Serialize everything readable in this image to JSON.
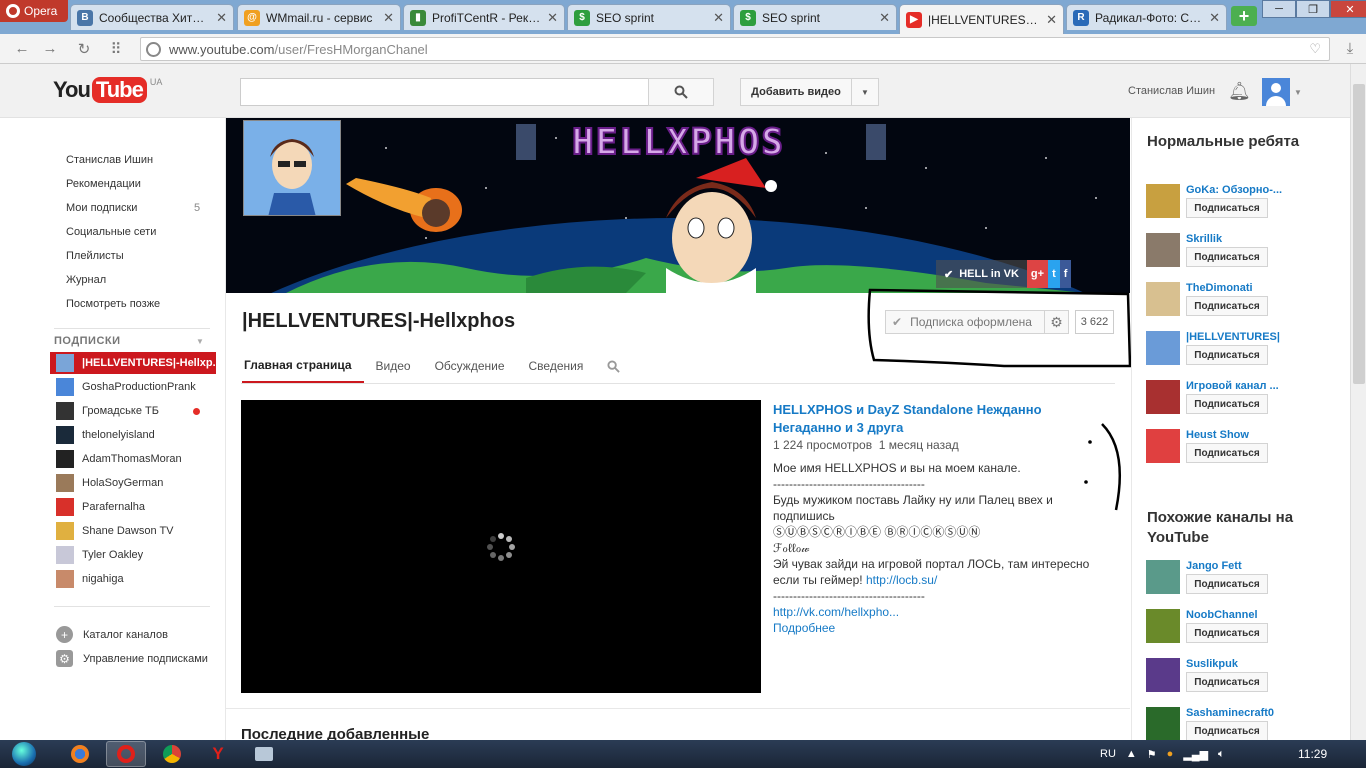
{
  "browser": {
    "menu_label": "Opera",
    "tabs": [
      {
        "title": "Сообщества Хитрак",
        "icon": "vk-icon",
        "color": "#4a76a8",
        "glyph": "B"
      },
      {
        "title": "WMmail.ru - сервис",
        "icon": "wmmail-icon",
        "color": "#f0a020",
        "glyph": "@"
      },
      {
        "title": "ProfiTCentR - Реклам",
        "icon": "profitcentr-icon",
        "color": "#3a8a3a",
        "glyph": "▮"
      },
      {
        "title": "SEO sprint",
        "icon": "seosprint-icon",
        "color": "#2e9e3e",
        "glyph": "$"
      },
      {
        "title": "SEO sprint",
        "icon": "seosprint-icon",
        "color": "#2e9e3e",
        "glyph": "$"
      },
      {
        "title": "|HELLVENTURES|-He",
        "icon": "youtube-icon",
        "color": "#e52d27",
        "glyph": "▶"
      },
      {
        "title": "Радикал-Фото: Созд",
        "icon": "radikal-icon",
        "color": "#2a6ab8",
        "glyph": "R"
      }
    ],
    "url_host": "www.youtube.com",
    "url_path": "/user/FresHMorganChanel"
  },
  "header": {
    "logo_you": "You",
    "logo_tube": "Tube",
    "region": "UA",
    "search_placeholder": "",
    "upload_label": "Добавить видео",
    "username": "Станислав Ишин"
  },
  "guide": {
    "items": [
      {
        "label": "Станислав Ишин",
        "count": ""
      },
      {
        "label": "Рекомендации",
        "count": ""
      },
      {
        "label": "Мои подписки",
        "count": "5"
      },
      {
        "label": "Социальные сети",
        "count": ""
      },
      {
        "label": "Плейлисты",
        "count": ""
      },
      {
        "label": "Журнал",
        "count": ""
      },
      {
        "label": "Посмотреть позже",
        "count": ""
      }
    ],
    "subs_heading": "ПОДПИСКИ",
    "subscriptions": [
      {
        "label": "|HELLVENTURES|-Hellxp...",
        "color": "#7aa5d8",
        "active": true
      },
      {
        "label": "GoshaProductionPrank",
        "color": "#4a86d9"
      },
      {
        "label": "Громадське ТБ",
        "color": "#333",
        "dot": true
      },
      {
        "label": "thelonelyisland",
        "color": "#1a2a3a"
      },
      {
        "label": "AdamThomasMoran",
        "color": "#222"
      },
      {
        "label": "HolaSoyGerman",
        "color": "#9a7a5a"
      },
      {
        "label": "Parafernalha",
        "color": "#d8302a"
      },
      {
        "label": "Shane Dawson TV",
        "color": "#e0b040"
      },
      {
        "label": "Tyler Oakley",
        "color": "#c8c8d8"
      },
      {
        "label": "nigahiga",
        "color": "#c88a6a"
      }
    ],
    "browse_channels": "Каталог каналов",
    "manage_subs": "Управление подписками"
  },
  "channel": {
    "banner_title": "HELLXPHOS",
    "banner_links": [
      "HELL in VK",
      "g+",
      "t",
      "f"
    ],
    "title": "|HELLVENTURES|-Hellxphos",
    "subscribed_label": "Подписка оформлена",
    "subscriber_count": "3 622",
    "tabs": [
      "Главная страница",
      "Видео",
      "Обсуждение",
      "Сведения"
    ]
  },
  "featured": {
    "title": "HELLXPHOS и DayZ Standalone Нежданно Негаданно и 3 друга",
    "views": "1 224 просмотров",
    "age": "1 месяц назад",
    "description_lines": [
      "Мое имя HELLXPHOS и вы на моем канале.",
      "--------------------------------------",
      "Будь мужиком поставь Лайку ну или Палец ввех и",
      "подпишись",
      "ⓈⓊⒷⓈⒸⓇⒾⒷⒺ ⒷⓇⒾⒸⓀⓈⓊⓃ",
      "ℱℴℓℓℴ𝓌",
      "Эй чувак зайди на игровой портал ЛОСЬ, там интересно",
      "если ты геймер! "
    ],
    "link1": "http://locb.su/",
    "separator": "--------------------------------------",
    "link2": "http://vk.com/hellxpho...",
    "more": "Подробнее"
  },
  "section": {
    "latest": "Последние добавленные"
  },
  "rail": {
    "heading1": "Нормальные ребята",
    "heading2": "Похожие каналы на YouTube",
    "subscribe_label": "Подписаться",
    "group1": [
      {
        "name": "GoKa: Обзорно-...",
        "color": "#c8a040"
      },
      {
        "name": "Skrillik",
        "color": "#8a7a6a"
      },
      {
        "name": "TheDimonati",
        "color": "#d8c090"
      },
      {
        "name": "|HELLVENTURES|",
        "color": "#6a9bd8"
      },
      {
        "name": "Игровой канал ...",
        "color": "#a83030"
      },
      {
        "name": "Heust Show",
        "color": "#e04040"
      }
    ],
    "group2": [
      {
        "name": "Jango Fett",
        "color": "#5a9a8a"
      },
      {
        "name": "NoobChannel",
        "color": "#6a8a2a"
      },
      {
        "name": "Suslikpuk",
        "color": "#5a3a8a"
      },
      {
        "name": "Sashaminecraft0",
        "color": "#2a6a2a"
      }
    ]
  },
  "taskbar": {
    "lang": "RU",
    "time": "11:29"
  }
}
